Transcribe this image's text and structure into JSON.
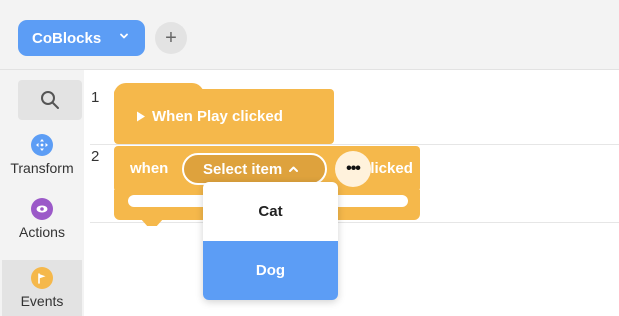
{
  "header": {
    "project_name": "CoBlocks",
    "add_symbol": "+"
  },
  "sidebar": {
    "categories": [
      {
        "label": "Transform",
        "color": "#5c9df5",
        "icon": "move-arrows-icon"
      },
      {
        "label": "Actions",
        "color": "#9b59c8",
        "icon": "eye-icon"
      },
      {
        "label": "Events",
        "color": "#f5b84b",
        "icon": "flag-icon"
      }
    ],
    "active": "Events"
  },
  "canvas": {
    "lines": [
      "1",
      "2"
    ],
    "blocks": {
      "hat_label": "When Play clicked",
      "when_label": "when",
      "select_label": "Select item",
      "kebab": "•••",
      "clicked_label": "clicked"
    }
  },
  "dropdown": {
    "options": [
      "Cat",
      "Dog"
    ],
    "selected": "Dog"
  },
  "colors": {
    "accent": "#5c9df5",
    "events": "#f5b84b"
  }
}
